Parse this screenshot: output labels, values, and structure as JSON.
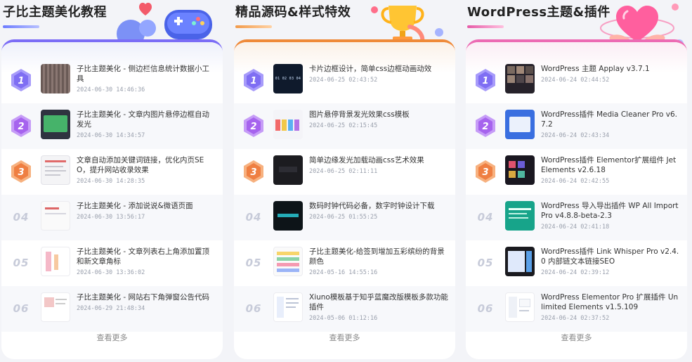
{
  "columns": [
    {
      "title": "子比主题美化教程",
      "more_label": "查看更多",
      "items": [
        {
          "rank": "1",
          "title": "子比主题美化 - 侧边栏信息统计数据小工具",
          "date": "2024-06-30 14:46:36"
        },
        {
          "rank": "2",
          "title": "子比主题美化 - 文章内图片悬停边框自动发光",
          "date": "2024-06-30 14:34:57"
        },
        {
          "rank": "3",
          "title": "文章自动添加关键词链接，优化内页SEO，提升网站收录效果",
          "date": "2024-06-30 14:28:35"
        },
        {
          "rank": "04",
          "title": "子比主题美化 - 添加说说&微语页面",
          "date": "2024-06-30 13:56:17"
        },
        {
          "rank": "05",
          "title": "子比主题美化 - 文章列表右上角添加置顶和新文章角标",
          "date": "2024-06-30 13:36:02"
        },
        {
          "rank": "06",
          "title": "子比主题美化 - 网站右下角弹窗公告代码",
          "date": "2024-06-29 21:48:34"
        }
      ]
    },
    {
      "title": "精品源码&样式特效",
      "more_label": "查看更多",
      "items": [
        {
          "rank": "1",
          "title": "卡片边框设计，简单css边框动画动效",
          "date": "2024-06-25 02:43:52",
          "thumb_text": "01 02 03 04"
        },
        {
          "rank": "2",
          "title": "图片悬停背景发光效果css模板",
          "date": "2024-06-25 02:15:45"
        },
        {
          "rank": "3",
          "title": "简单边缘发光加载动画css艺术效果",
          "date": "2024-06-25 02:11:11"
        },
        {
          "rank": "04",
          "title": "数码时钟代码必备，数字时钟设计下载",
          "date": "2024-06-25 01:55:25"
        },
        {
          "rank": "05",
          "title": "子比主题美化-给签到增加五彩缤纷的背景颜色",
          "date": "2024-05-16 14:55:16"
        },
        {
          "rank": "06",
          "title": "Xiuno模板基于知乎蓝魔改版模板多款功能插件",
          "date": "2024-05-06 01:12:16"
        }
      ]
    },
    {
      "title": "WordPress主题&插件",
      "more_label": "查看更多",
      "items": [
        {
          "rank": "1",
          "title": "WordPress 主题 Applay v3.7.1",
          "date": "2024-06-24 02:44:52"
        },
        {
          "rank": "2",
          "title": "WordPress插件 Media Cleaner Pro v6.7.2",
          "date": "2024-06-24 02:43:34"
        },
        {
          "rank": "3",
          "title": "WordPress插件 Elementor扩展组件 JetElements v2.6.18",
          "date": "2024-06-24 02:42:55"
        },
        {
          "rank": "04",
          "title": "WordPress 导入导出插件 WP All Import Pro v4.8.8-beta-2.3",
          "date": "2024-06-24 02:41:18"
        },
        {
          "rank": "05",
          "title": "WordPress插件 Link Whisper Pro v2.4.0 内部链文本链接SEO",
          "date": "2024-06-24 02:39:12"
        },
        {
          "rank": "06",
          "title": "WordPress Elementor Pro 扩展插件 Unlimited Elements v1.5.109",
          "date": "2024-06-24 02:37:52"
        }
      ]
    }
  ],
  "colors": {
    "medal_1": "#8f7cf7",
    "medal_2": "#a66af0",
    "medal_3": "#f08a4e",
    "tab_1_accent": "#7b6cf6",
    "tab_2_accent": "#ef8a3a",
    "tab_3_accent": "#ec6bb3"
  },
  "icons": {
    "col_1_deco": "gamepad-icon",
    "col_2_deco": "trophy-icon",
    "col_3_deco": "heart-icon",
    "medal": "medal-icon"
  }
}
